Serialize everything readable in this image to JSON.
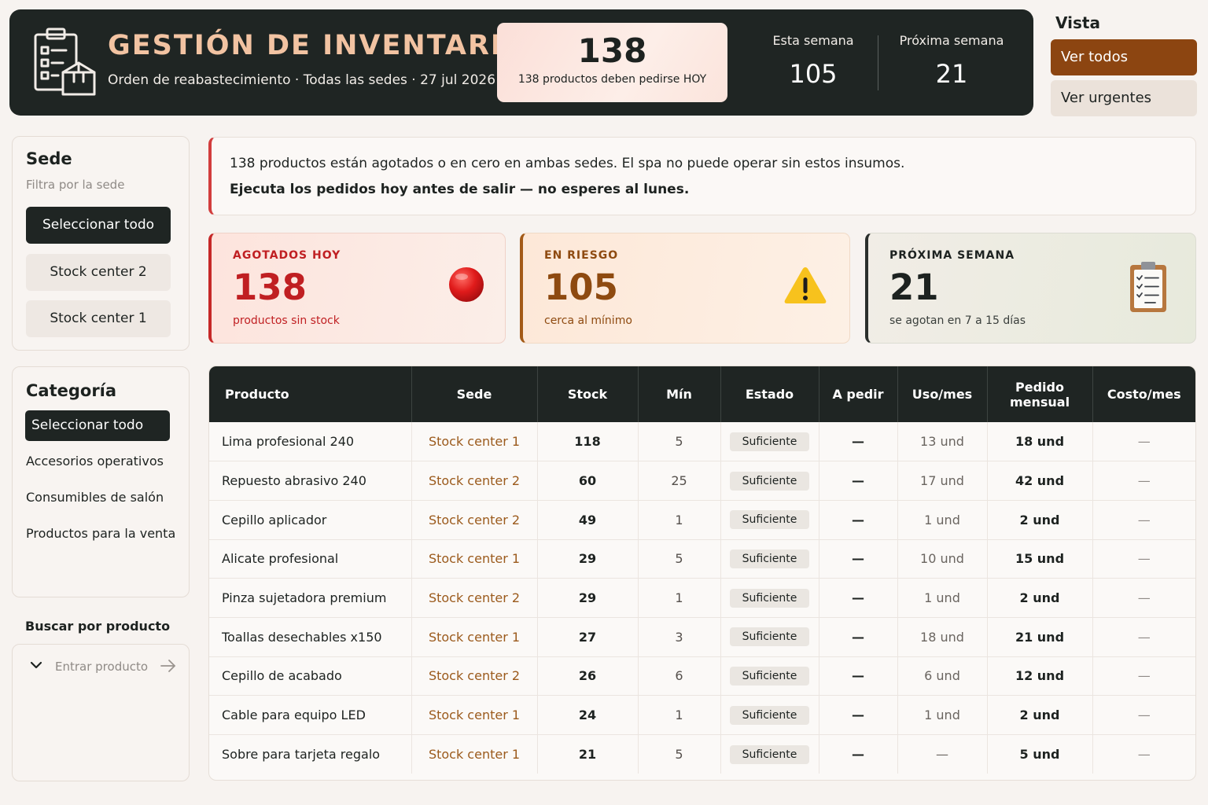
{
  "header": {
    "title": "GESTIÓN DE INVENTARIOS",
    "subtitle": "Orden de reabastecimiento · Todas las sedes · 27 jul 2026",
    "hero_value": "138",
    "hero_text": "138 productos deben pedirse HOY",
    "stats": [
      {
        "label": "Esta semana",
        "value": "105"
      },
      {
        "label": "Próxima semana",
        "value": "21"
      }
    ],
    "icon": "inventory-clipboard-box-icon"
  },
  "vista": {
    "title": "Vista",
    "options": [
      "Ver todos",
      "Ver urgentes"
    ],
    "selected": "Ver todos"
  },
  "sede": {
    "title": "Sede",
    "subtitle": "Filtra por la sede",
    "select_all": "Seleccionar todo",
    "options": [
      "Stock center 2",
      "Stock center 1"
    ]
  },
  "categoria": {
    "title": "Categoría",
    "select_all": "Seleccionar todo",
    "options": [
      "Accesorios operativos",
      "Consumibles de salón",
      "Productos para la venta"
    ]
  },
  "search": {
    "title": "Buscar por producto",
    "placeholder": "Entrar producto",
    "value": ""
  },
  "alert": {
    "line1": "138 productos están agotados o en cero en ambas sedes. El spa no puede operar sin estos insumos.",
    "line2": "Ejecuta los pedidos hoy antes de salir — no esperes al lunes."
  },
  "kpis": [
    {
      "label": "AGOTADOS HOY",
      "value": "138",
      "caption": "productos sin stock",
      "icon": "red-circle-icon",
      "color": "#c01f22"
    },
    {
      "label": "EN RIESGO",
      "value": "105",
      "caption": "cerca al mínimo",
      "icon": "warning-triangle-icon",
      "color": "#8e4a10"
    },
    {
      "label": "PRÓXIMA SEMANA",
      "value": "21",
      "caption": "se agotan en 7 a 15 días",
      "icon": "clipboard-checklist-icon",
      "color": "#1d2220"
    }
  ],
  "table": {
    "columns": [
      "Producto",
      "Sede",
      "Stock",
      "Mín",
      "Estado",
      "A pedir",
      "Uso/mes",
      "Pedido mensual",
      "Costo/mes"
    ],
    "rows": [
      [
        "Lima profesional 240",
        "Stock center 1",
        "118",
        "5",
        "Suficiente",
        "—",
        "13 und",
        "18 und",
        "—"
      ],
      [
        "Repuesto abrasivo 240",
        "Stock center 2",
        "60",
        "25",
        "Suficiente",
        "—",
        "17 und",
        "42 und",
        "—"
      ],
      [
        "Cepillo aplicador",
        "Stock center 2",
        "49",
        "1",
        "Suficiente",
        "—",
        "1 und",
        "2 und",
        "—"
      ],
      [
        "Alicate profesional",
        "Stock center 1",
        "29",
        "5",
        "Suficiente",
        "—",
        "10 und",
        "15 und",
        "—"
      ],
      [
        "Pinza sujetadora premium",
        "Stock center 2",
        "29",
        "1",
        "Suficiente",
        "—",
        "1 und",
        "2 und",
        "—"
      ],
      [
        "Toallas desechables x150",
        "Stock center 1",
        "27",
        "3",
        "Suficiente",
        "—",
        "18 und",
        "21 und",
        "—"
      ],
      [
        "Cepillo de acabado",
        "Stock center 2",
        "26",
        "6",
        "Suficiente",
        "—",
        "6 und",
        "12 und",
        "—"
      ],
      [
        "Cable para equipo LED",
        "Stock center 1",
        "24",
        "1",
        "Suficiente",
        "—",
        "1 und",
        "2 und",
        "—"
      ],
      [
        "Sobre para tarjeta regalo",
        "Stock center 1",
        "21",
        "5",
        "Suficiente",
        "—",
        "—",
        "5 und",
        "—"
      ]
    ]
  },
  "colors": {
    "dark": "#1f2523",
    "accent": "#8c4511",
    "title_peach": "#f2c3a2",
    "danger": "#c62828",
    "warning": "#a35a17",
    "sede_link": "#9b5a1c"
  }
}
